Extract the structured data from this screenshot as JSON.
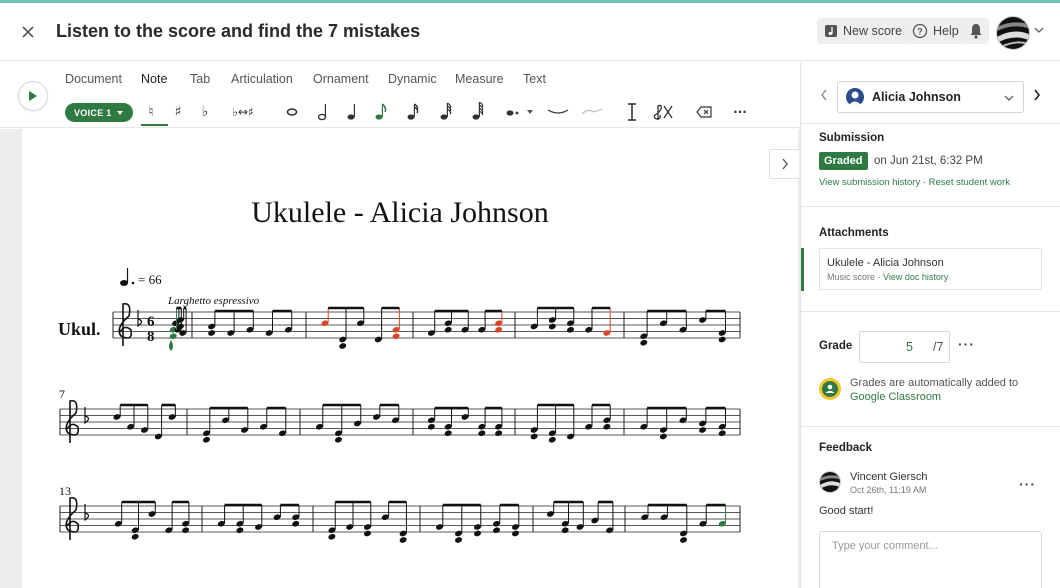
{
  "header": {
    "title": "Listen to the score and find the 7 mistakes",
    "new_score_label": "New score",
    "help_label": "Help"
  },
  "toolbar": {
    "tabs": [
      "Document",
      "Note",
      "Tab",
      "Articulation",
      "Ornament",
      "Dynamic",
      "Measure",
      "Text"
    ],
    "active_tab": "Note",
    "voice_label": "VOICE 1",
    "tool_glyphs": {
      "natural": "♮",
      "sharp": "♯",
      "flat": "♭",
      "enharmonic": "♭↔♯",
      "whole": "𝅝",
      "more": "···"
    },
    "tool_icons": [
      "natural-icon",
      "sharp-icon",
      "flat-icon",
      "enharmonic-icon",
      "whole-note-icon",
      "half-note-icon",
      "quarter-note-icon",
      "eighth-note-icon",
      "sixteenth-note-icon",
      "thirty-second-note-icon",
      "sixty-fourth-note-icon",
      "dotted-note-icon",
      "tie-icon",
      "slur-icon",
      "cursor-icon",
      "clef-icon",
      "delete-icon",
      "more-icon"
    ]
  },
  "score": {
    "title": "Ukulele - Alicia Johnson",
    "tempo_value": "= 66",
    "expression": "Larghetto espressivo",
    "instrument": "Ukul.",
    "time_signature": [
      "6",
      "8"
    ],
    "measure_numbers": [
      "7",
      "13"
    ]
  },
  "panel": {
    "student_name": "Alicia Johnson",
    "submission": {
      "title": "Submission",
      "status": "Graded",
      "date": "on Jun 21st, 6:32 PM",
      "history_link": "View submission history",
      "separator": "·",
      "reset_link": "Reset student work"
    },
    "attachments": {
      "title": "Attachments",
      "name": "Ukulele - Alicia Johnson",
      "type": "Music score",
      "separator": "·",
      "history_link": "View doc history"
    },
    "grade": {
      "label": "Grade",
      "value": "5",
      "max": "/7",
      "note": "Grades are automatically added to",
      "classroom_link": "Google Classroom"
    },
    "feedback": {
      "title": "Feedback",
      "author": "Vincent Giersch",
      "time": "Oct 26th, 11:19 AM",
      "text": "Good start!",
      "placeholder": "Type your comment..."
    }
  },
  "colors": {
    "accent": "#2f7a43",
    "error_note": "#d9472b",
    "top_stripe": "#6cc3b5"
  }
}
